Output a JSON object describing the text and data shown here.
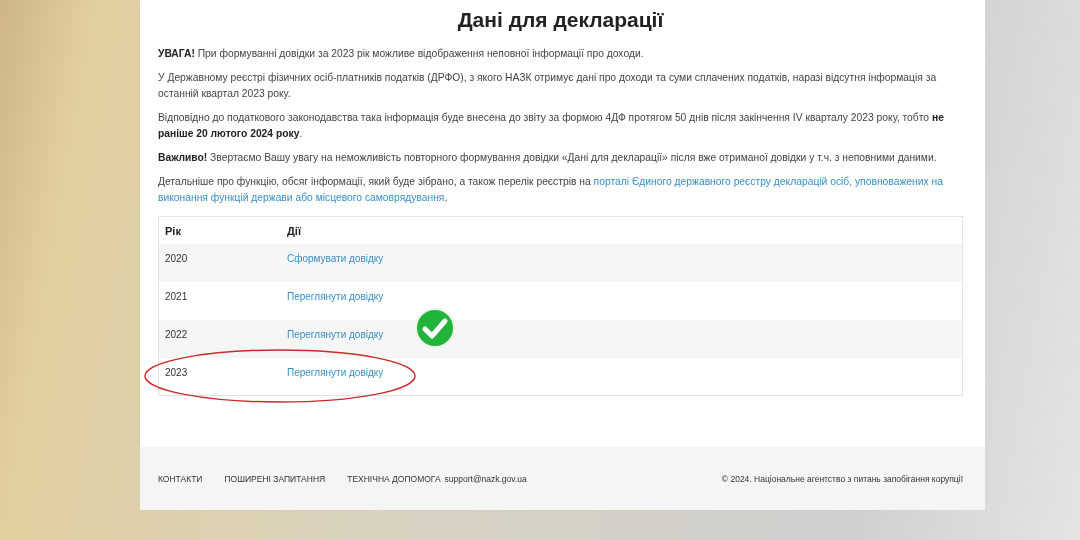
{
  "title": "Дані для декларації",
  "paragraphs": [
    {
      "text": "**УВАГА!** При формуванні довідки за 2023 рік можливе відображення неповної інформації про доходи."
    },
    {
      "text": "У Державному реєстрі фізичних осіб-платників податків (ДРФО), з якого НАЗК отримує дані про доходи та суми сплачених податків, наразі відсутня інформація за останній квартал 2023 року."
    },
    {
      "text": "Відповідно до податкового законодавства така інформація буде внесена до звіту за формою 4ДФ протягом 50 днів після закінчення IV кварталу 2023 року, тобто **не раніше 20 лютого 2024 року**."
    },
    {
      "text": "**Важливо!** Звертаємо Вашу увагу на неможливість повторного формування довідки «Дані для декларації» після вже отриманої довідки у т.ч. з неповними даними."
    },
    {
      "text": "Детальніше про функцію, обсяг інформації, який буде зібрано, а також перелік реєстрів на ",
      "links": [
        "порталі Єдиного державного реєстру декларацій осіб, уповноважених на",
        "виконання функцій держави або місцевого самоврядування"
      ],
      "after": "."
    }
  ],
  "table": {
    "columns": [
      "Рік",
      "Дії"
    ],
    "rows": [
      {
        "year": "2020",
        "action": "Сформувати довідку",
        "marked": false,
        "circled": false
      },
      {
        "year": "2021",
        "action": "Переглянути довідку",
        "marked": false,
        "circled": false
      },
      {
        "year": "2022",
        "action": "Переглянути довідку",
        "marked": true,
        "circled": false
      },
      {
        "year": "2023",
        "action": "Переглянути довідку",
        "marked": false,
        "circled": true
      }
    ]
  },
  "footer": {
    "links": [
      "КОНТАКТИ",
      "ПОШИРЕНІ ЗАПИТАННЯ",
      "ТЕХНІЧНА ДОПОМОГА"
    ],
    "email": "support@nazk.gov.ua",
    "copyright": "© 2024. Національне агентство з питань запобігання корупції"
  }
}
